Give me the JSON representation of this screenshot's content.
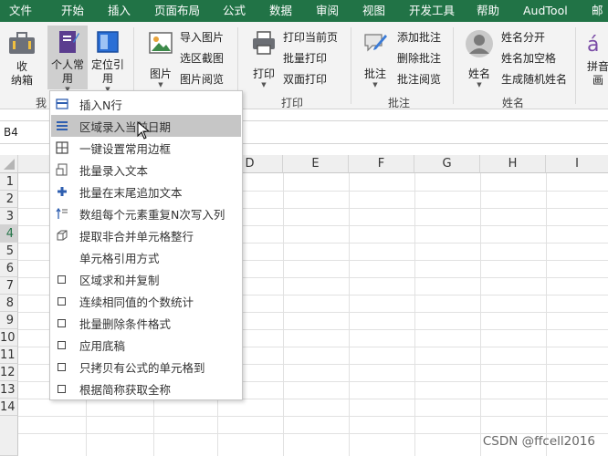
{
  "tabs": [
    "文件",
    "开始",
    "插入",
    "页面布局",
    "公式",
    "数据",
    "审阅",
    "视图",
    "开发工具",
    "帮助",
    "AudTool",
    "邮"
  ],
  "ribbon": {
    "toolbox": {
      "line1": "收",
      "line2": "纳箱"
    },
    "personal": {
      "line1": "个人常",
      "line2": "用"
    },
    "locate": {
      "line1": "定位引",
      "line2": "用"
    },
    "picture": {
      "label": "图片"
    },
    "import_picture": "导入图片",
    "select_screenshot": "选区截图",
    "picture_browse": "图片阅览",
    "print": {
      "label": "打印"
    },
    "print_current": "打印当前页",
    "batch_print": "批量打印",
    "duplex_print": "双面打印",
    "annotate": {
      "label": "批注"
    },
    "add_note": "添加批注",
    "delete_note": "删除批注",
    "note_browse": "批注阅览",
    "name": {
      "label": "姓名"
    },
    "split_name": "姓名分开",
    "name_space": "姓名加空格",
    "random_name": "生成随机姓名",
    "pinyin": {
      "line1": "拼音",
      "line2": "画"
    },
    "groups": {
      "mine": "我",
      "print": "打印",
      "annotate": "批注",
      "name": "姓名"
    }
  },
  "namebox": "B4",
  "columns": [
    "D",
    "E",
    "F",
    "G",
    "H",
    "I"
  ],
  "rows": [
    "1",
    "2",
    "3",
    "4",
    "5",
    "6",
    "7",
    "8",
    "9",
    "10",
    "11",
    "12",
    "13",
    "14"
  ],
  "selected_row": "4",
  "menu_items": [
    {
      "label": "插入N行",
      "icon": "insert-rows-icon"
    },
    {
      "label": "区域录入当前日期",
      "icon": "list-lines-icon",
      "highlight": true
    },
    {
      "label": "一键设置常用边框",
      "icon": "border-grid-icon"
    },
    {
      "label": "批量录入文本",
      "icon": "text-doc-icon"
    },
    {
      "label": "批量在末尾追加文本",
      "icon": "plus-icon"
    },
    {
      "label": "数组每个元素重复N次写入列",
      "icon": "repeat-icon"
    },
    {
      "label": "提取非合并单元格整行",
      "icon": "cube-icon"
    },
    {
      "label": "单元格引用方式",
      "icon": "none"
    },
    {
      "label": "区域求和并复制",
      "icon": "checkbox-icon"
    },
    {
      "label": "连续相同值的个数统计",
      "icon": "checkbox-icon"
    },
    {
      "label": "批量删除条件格式",
      "icon": "checkbox-icon"
    },
    {
      "label": "应用底稿",
      "icon": "checkbox-icon"
    },
    {
      "label": "只拷贝有公式的单元格到",
      "icon": "checkbox-icon"
    },
    {
      "label": "根据简称获取全称",
      "icon": "checkbox-icon"
    }
  ],
  "watermark": "CSDN @ffcell2016",
  "colors": {
    "tabbar": "#217346",
    "ribbon": "#f3f3f3",
    "highlight": "#c6c6c6"
  }
}
